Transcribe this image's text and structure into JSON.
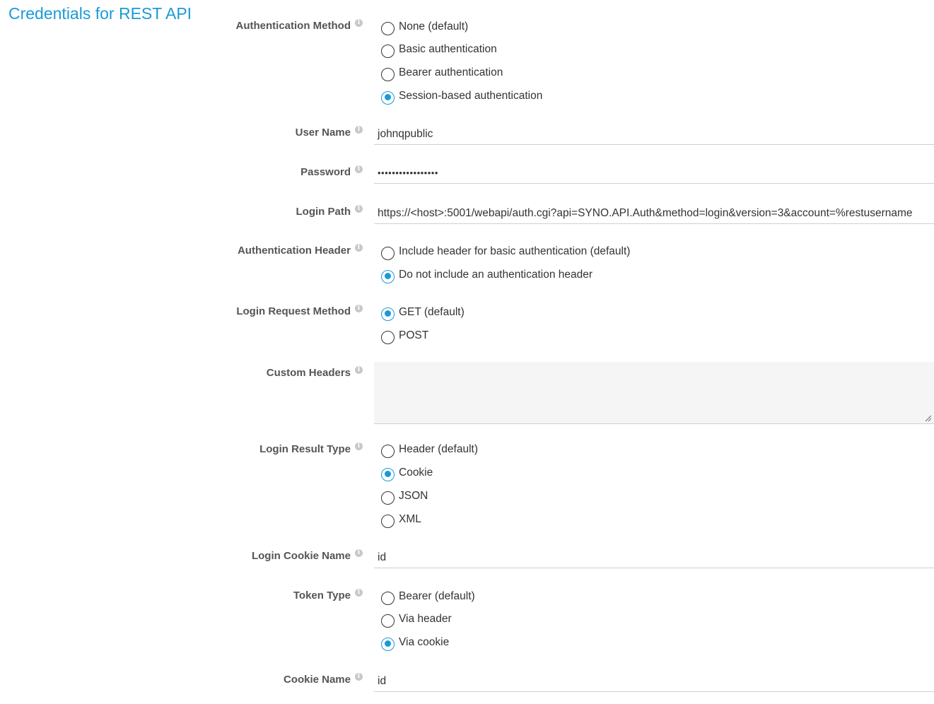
{
  "section_title": "Credentials for REST API",
  "info_glyph": "i",
  "fields": {
    "auth_method": {
      "label": "Authentication Method",
      "options": [
        {
          "label": "None (default)",
          "checked": false
        },
        {
          "label": "Basic authentication",
          "checked": false
        },
        {
          "label": "Bearer authentication",
          "checked": false
        },
        {
          "label": "Session-based authentication",
          "checked": true
        }
      ]
    },
    "user_name": {
      "label": "User Name",
      "value": "johnqpublic"
    },
    "password": {
      "label": "Password",
      "value": "•••••••••••••••••"
    },
    "login_path": {
      "label": "Login Path",
      "value": "https://<host>:5001/webapi/auth.cgi?api=SYNO.API.Auth&method=login&version=3&account=%restusername"
    },
    "auth_header": {
      "label": "Authentication Header",
      "options": [
        {
          "label": "Include header for basic authentication (default)",
          "checked": false
        },
        {
          "label": "Do not include an authentication header",
          "checked": true
        }
      ]
    },
    "login_request_method": {
      "label": "Login Request Method",
      "options": [
        {
          "label": "GET (default)",
          "checked": true
        },
        {
          "label": "POST",
          "checked": false
        }
      ]
    },
    "custom_headers": {
      "label": "Custom Headers",
      "value": ""
    },
    "login_result_type": {
      "label": "Login Result Type",
      "options": [
        {
          "label": "Header (default)",
          "checked": false
        },
        {
          "label": "Cookie",
          "checked": true
        },
        {
          "label": "JSON",
          "checked": false
        },
        {
          "label": "XML",
          "checked": false
        }
      ]
    },
    "login_cookie_name": {
      "label": "Login Cookie Name",
      "value": "id"
    },
    "token_type": {
      "label": "Token Type",
      "options": [
        {
          "label": "Bearer (default)",
          "checked": false
        },
        {
          "label": "Via header",
          "checked": false
        },
        {
          "label": "Via cookie",
          "checked": true
        }
      ]
    },
    "cookie_name": {
      "label": "Cookie Name",
      "value": "id"
    }
  },
  "colors": {
    "accent": "#1a9ad6",
    "label": "#555555",
    "text": "#333333"
  }
}
